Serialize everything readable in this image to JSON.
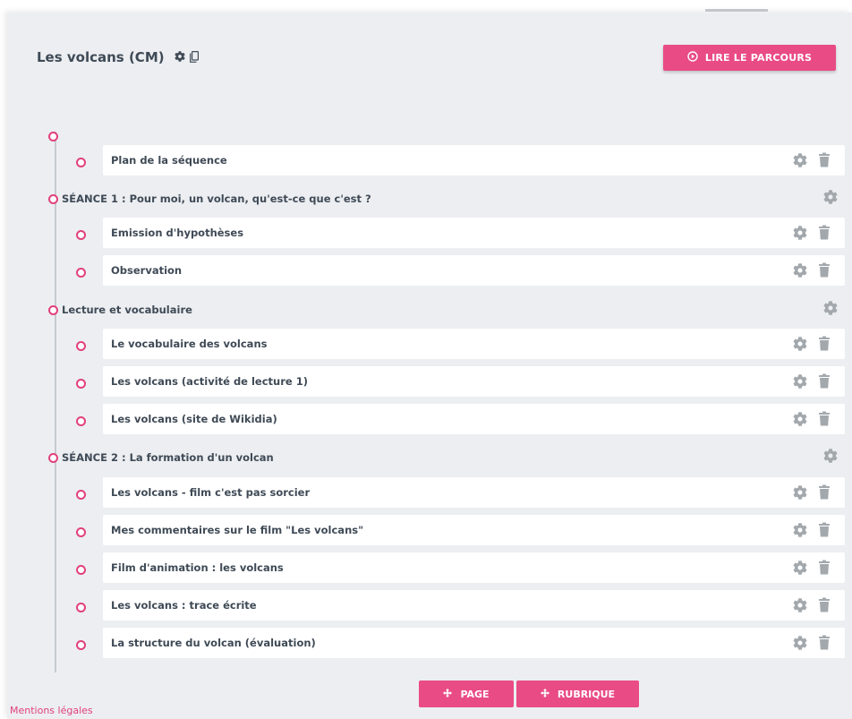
{
  "header": {
    "title": "Les volcans (CM)",
    "read_button_label": "LIRE LE PARCOURS"
  },
  "sections": [
    {
      "title": "",
      "items": [
        {
          "label": "Plan de la séquence"
        }
      ]
    },
    {
      "title": "SÉANCE 1 : Pour moi, un volcan, qu'est-ce que c'est ?",
      "items": [
        {
          "label": "Emission d'hypothèses"
        },
        {
          "label": "Observation"
        }
      ]
    },
    {
      "title": "Lecture et vocabulaire",
      "items": [
        {
          "label": "Le vocabulaire des volcans"
        },
        {
          "label": "Les volcans (activité de lecture 1)"
        },
        {
          "label": "Les volcans (site de Wikidia)"
        }
      ]
    },
    {
      "title": "SÉANCE 2 : La formation d'un volcan",
      "items": [
        {
          "label": "Les volcans - film c'est pas sorcier"
        },
        {
          "label": "Mes commentaires sur le film \"Les volcans\""
        },
        {
          "label": "Film d'animation : les volcans"
        },
        {
          "label": "Les volcans : trace écrite"
        },
        {
          "label": "La structure du volcan (évaluation)"
        }
      ]
    }
  ],
  "footer": {
    "page_button_label": "PAGE",
    "rubrique_button_label": "RUBRIQUE",
    "legal_link": "Mentions légales"
  },
  "icons": {
    "title_settings": "gear-icon",
    "title_copy": "copy-icon",
    "read_button": "play-circle-icon",
    "item_settings": "gear-icon",
    "item_delete": "trash-icon",
    "add_buttons": "move-arrows-icon"
  },
  "colors": {
    "accent": "#e94b85",
    "panel_background": "#eceef1",
    "icon_gray": "#a3a8ad"
  }
}
